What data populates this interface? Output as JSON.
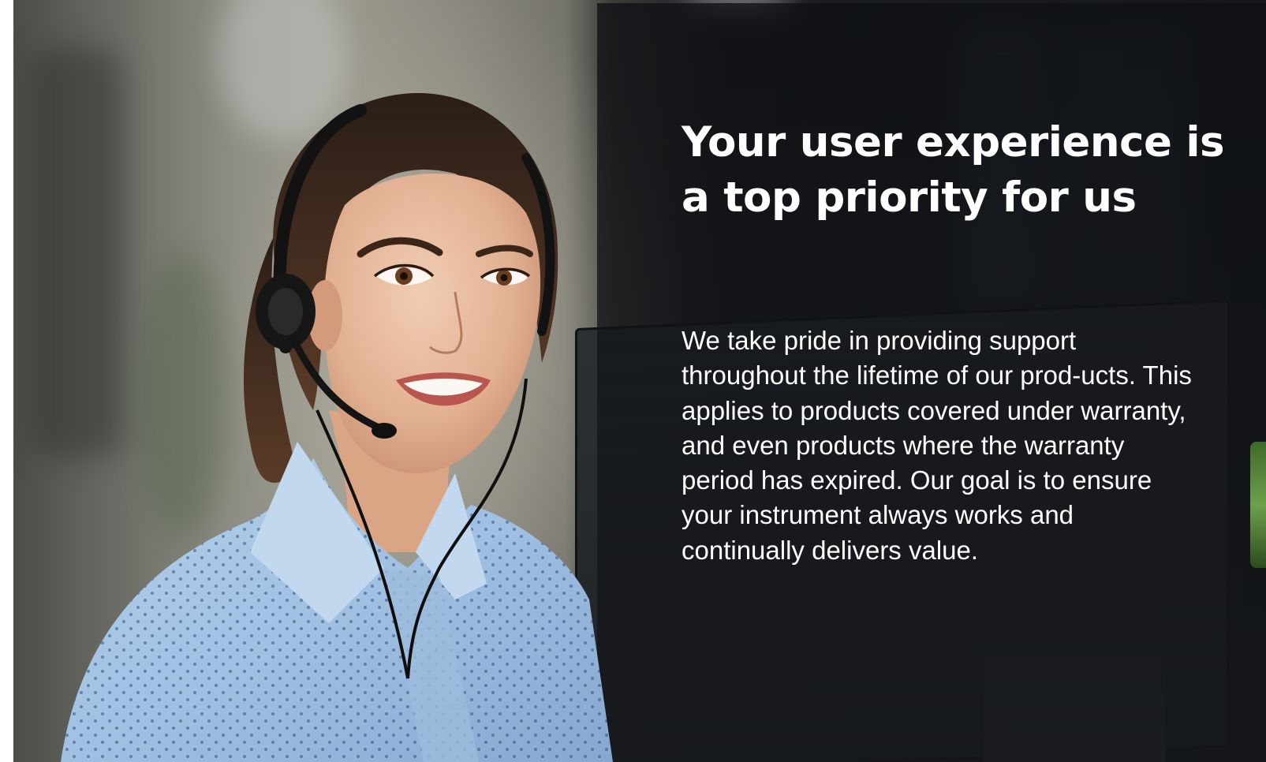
{
  "hero": {
    "headline": "Your user experience is a top priority for us",
    "body": "We take pride in providing support throughout the lifetime of our prod-ucts. This applies to products covered under warranty, and even products where the warranty period has expired. Our goal is to ensure your instrument always works and continually delivers value.",
    "photo": {
      "subject": "support-agent-with-headset"
    }
  },
  "colors": {
    "text": "#ffffff",
    "overlay": "#121418",
    "shirt": "#a9c6e4",
    "hair": "#3a2a20"
  }
}
